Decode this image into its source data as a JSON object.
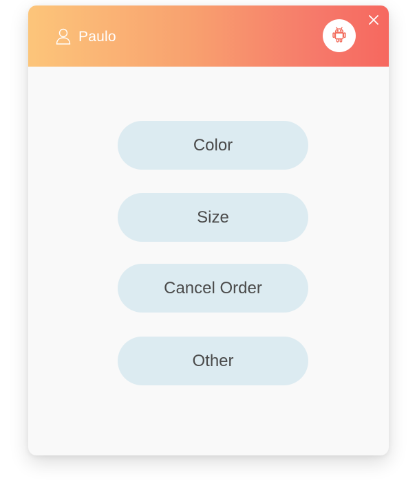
{
  "header": {
    "user_name": "Paulo",
    "user_icon": "user-icon",
    "avatar_icon": "android-icon",
    "close_icon": "close-icon"
  },
  "options": [
    {
      "label": "Color"
    },
    {
      "label": "Size"
    },
    {
      "label": "Cancel Order"
    },
    {
      "label": "Other"
    }
  ],
  "colors": {
    "header_gradient_start": "#fcc57a",
    "header_gradient_end": "#f6685f",
    "option_bg": "#dcebf1",
    "option_text": "#4a4a4a",
    "android_icon": "#f26b5b",
    "card_bg": "#f9f9f9"
  }
}
